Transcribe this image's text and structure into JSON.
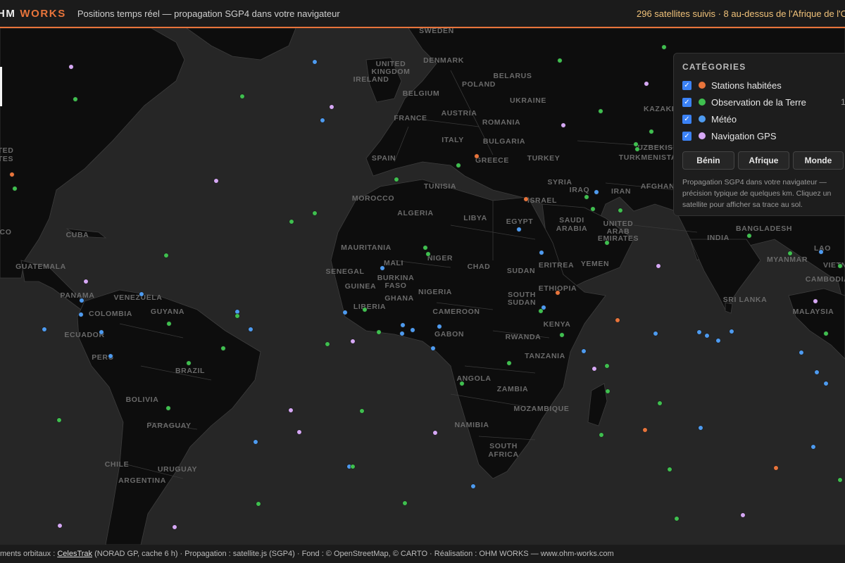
{
  "header": {
    "brand_a": "HM",
    "brand_b": "WORKS",
    "tagline": "Positions temps réel — propagation SGP4 dans votre navigateur",
    "status": "296 satellites suivis · 8 au-dessus de l'Afrique de l'O"
  },
  "panel": {
    "title": "CATÉGORIES",
    "categories": [
      {
        "label": "Stations habitées",
        "color": "#e8743b",
        "count": ""
      },
      {
        "label": "Observation de la Terre",
        "color": "#3fbf4f",
        "count": "1"
      },
      {
        "label": "Météo",
        "color": "#4e9bf0",
        "count": ""
      },
      {
        "label": "Navigation GPS",
        "color": "#d6a8f5",
        "count": ""
      }
    ],
    "buttons": [
      "Bénin",
      "Afrique",
      "Monde"
    ],
    "note": "Propagation SGP4 dans votre navigateur — précision typique de quelques km. Cliquez un satellite pour afficher sa trace au sol."
  },
  "footer": {
    "prefix": "ments orbitaux : ",
    "link": "CelesTrak",
    "suffix": " (NORAD GP, cache 6 h) · Propagation : satellite.js (SGP4) · Fond : © OpenStreetMap, © CARTO · Réalisation : OHM WORKS — www.ohm-works.com"
  },
  "places": [
    "SWEDEN",
    "DENMARK",
    "UNITED",
    "KINGDOM",
    "IRELAND",
    "BELARUS",
    "POLAND",
    "BELGIUM",
    "UKRAINE",
    "FRANCE",
    "AUSTRIA",
    "ROMANIA",
    "KAZAKH",
    "ITALY",
    "BULGARIA",
    "UZBEKIST",
    "SPAIN",
    "GREECE",
    "TURKEY",
    "TURKMENISTAN",
    "TUNISIA",
    "SYRIA",
    "IRAQ",
    "IRAN",
    "AFGHAN",
    "MOROCCO",
    "ISRAEL",
    "ALGERIA",
    "LIBYA",
    "EGYPT",
    "SAUDI",
    "ARABIA",
    "UNITED",
    "ARAB",
    "EMIRATES",
    "BANGLADESH",
    "INDIA",
    "MAURITANIA",
    "MALI",
    "NIGER",
    "CHAD",
    "SUDAN",
    "ERITREA",
    "YEMEN",
    "MYANMAR",
    "VIETNA",
    "SENEGAL",
    "BURKINA",
    "FASO",
    "GUINEA",
    "NIGERIA",
    "ETHIOPIA",
    "CAMBODIA",
    "LIBERIA",
    "GHANA",
    "CAMEROON",
    "SOUTH",
    "SUDAN",
    "SRI LANKA",
    "MALAYSIA",
    "GABON",
    "KENYA",
    "RWANDA",
    "TANZANIA",
    "ANGOLA",
    "ZAMBIA",
    "MOZAMBIQUE",
    "NAMIBIA",
    "SOUTH",
    "AFRICA",
    "VENEZUELA",
    "GUYANA",
    "COLOMBIA",
    "PANAMA",
    "ECUADOR",
    "PERU",
    "BRAZIL",
    "BOLIVIA",
    "PARAGUAY",
    "CHILE",
    "URUGUAY",
    "ARGENTINA",
    "GUATEMALA",
    "CUBA",
    "TED",
    "TES",
    "CO",
    "LAO"
  ]
}
